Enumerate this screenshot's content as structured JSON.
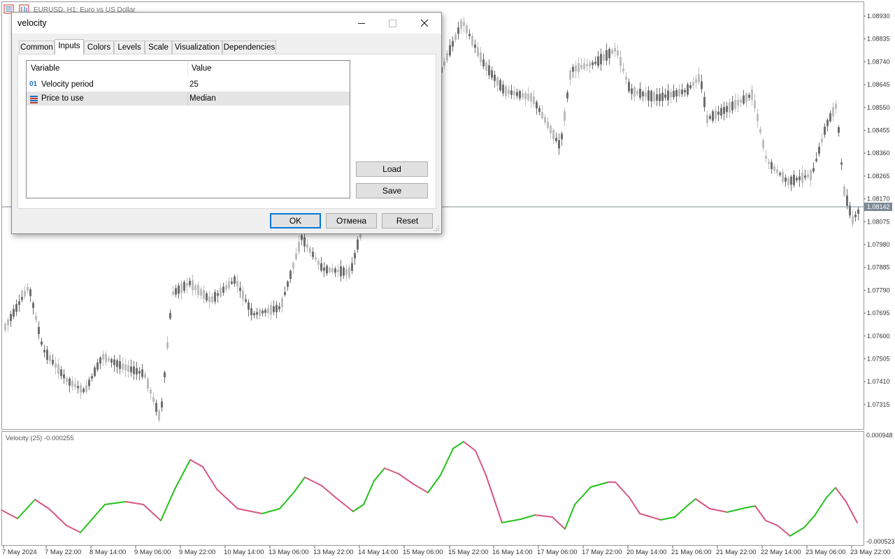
{
  "window": {
    "title": "EURUSD, H1:  Euro vs US Dollar"
  },
  "price_axis": {
    "labels": [
      "1.08930",
      "1.08835",
      "1.08740",
      "1.08645",
      "1.08550",
      "1.08455",
      "1.08360",
      "1.08265",
      "1.08170",
      "1.08075",
      "1.07980",
      "1.07885",
      "1.07790",
      "1.07695",
      "1.07600",
      "1.07505",
      "1.07410",
      "1.07315"
    ],
    "current_price": "1.08142"
  },
  "time_axis": {
    "labels": [
      "7 May 2024",
      "7 May 22:00",
      "8 May 14:00",
      "9 May 06:00",
      "9 May 22:00",
      "10 May 14:00",
      "13 May 06:00",
      "13 May 22:00",
      "14 May 14:00",
      "15 May 06:00",
      "15 May 22:00",
      "16 May 14:00",
      "17 May 06:00",
      "17 May 22:00",
      "20 May 14:00",
      "21 May 06:00",
      "21 May 22:00",
      "22 May 14:00",
      "23 May 06:00",
      "23 May 22:00"
    ]
  },
  "indicator": {
    "label": "Velocity (25) -0.000255",
    "max_label": "0.000948",
    "min_label": "-0.000523",
    "colors": {
      "rising": "#22c21a",
      "falling": "#d4587e"
    }
  },
  "colors": {
    "bull_candle": "#bdbdbd",
    "bear_candle": "#6e6e6e",
    "price_line": "#7d8a96",
    "price_tag": "#7d8a96"
  },
  "dialog": {
    "title": "velocity",
    "tabs": [
      {
        "label": "Common"
      },
      {
        "label": "Inputs"
      },
      {
        "label": "Colors"
      },
      {
        "label": "Levels"
      },
      {
        "label": "Scale"
      },
      {
        "label": "Visualization"
      },
      {
        "label": "Dependencies"
      }
    ],
    "active_tab": "Inputs",
    "grid": {
      "col_variable": "Variable",
      "col_value": "Value",
      "rows": [
        {
          "icon": "int-param-icon",
          "icon_text": "01",
          "variable": "Velocity period",
          "value": "25"
        },
        {
          "icon": "enum-param-icon",
          "variable": "Price to use",
          "value": "Median"
        }
      ]
    },
    "load_label": "Load",
    "save_label": "Save",
    "ok_label": "OK",
    "cancel_label": "Отмена",
    "reset_label": "Reset"
  }
}
